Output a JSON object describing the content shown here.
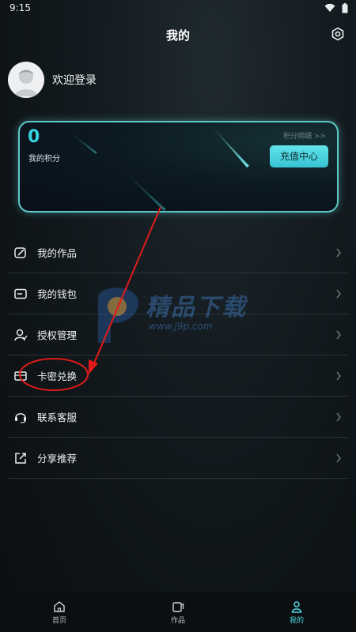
{
  "status_bar": {
    "time": "9:15"
  },
  "header": {
    "title": "我的"
  },
  "profile": {
    "login_text": "欢迎登录"
  },
  "points_card": {
    "value": "0",
    "label": "我的积分",
    "detail_link": "积分明细 >>",
    "recharge_button": "充值中心"
  },
  "menu": {
    "items": [
      {
        "label": "我的作品",
        "icon": "works-icon"
      },
      {
        "label": "我的钱包",
        "icon": "wallet-icon"
      },
      {
        "label": "授权管理",
        "icon": "authorization-icon"
      },
      {
        "label": "卡密兑换",
        "icon": "card-icon"
      },
      {
        "label": "联系客服",
        "icon": "headset-icon"
      },
      {
        "label": "分享推荐",
        "icon": "share-icon"
      }
    ]
  },
  "watermark": {
    "brand": "精品下载",
    "url": "www.j9p.com"
  },
  "bottom_nav": {
    "items": [
      {
        "label": "首页",
        "icon": "home-icon"
      },
      {
        "label": "作品",
        "icon": "works-tab-icon"
      },
      {
        "label": "我的",
        "icon": "profile-icon"
      }
    ],
    "active_index": 2
  },
  "colors": {
    "accent": "#38d3e0",
    "annotation": "#e11b1b"
  }
}
